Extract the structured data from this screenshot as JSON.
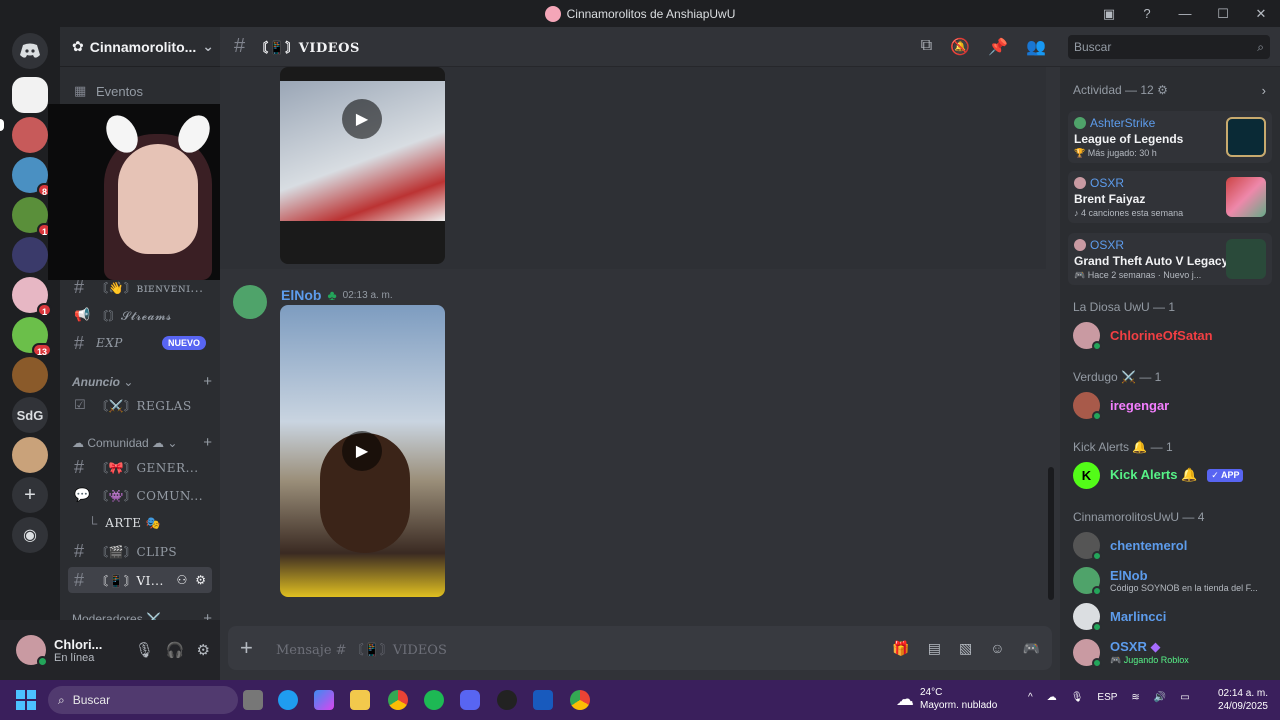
{
  "window": {
    "title": "Cinnamorolitos de AnshiapUwU"
  },
  "guild": {
    "name": "Cinnamorolito...",
    "events": "Eventos"
  },
  "rail": {
    "dm": "Discord",
    "sdg": "SdG",
    "badges": [
      "8",
      "1",
      "1",
      "13"
    ]
  },
  "channels": {
    "bienvenida": "〘👋〙ʙɪᴇɴᴠᴇɴɪ...",
    "streams": "〘〙𝓢𝓽𝓻𝓮𝓪𝓶𝓼",
    "exp": "EXP",
    "nuevo": "NUEVO",
    "cat_anuncio": "Anuncio",
    "reglas": "〘⚔️〙REGLAS",
    "cat_comunidad": "Comunidad",
    "general": "〘🎀〙GENER...",
    "comunidad": "〘👾〙COMUN...",
    "arte": "ARTE 🎭",
    "clips": "〘🎬〙CLIPS",
    "videos": "〘📱〙VI...",
    "cat_moderadores": "Moderadores ⚔️"
  },
  "user": {
    "name": "Chlori...",
    "status": "En línea"
  },
  "chat": {
    "channel_name": "〘📱〙VIDEOS",
    "author": "ElNob",
    "time": "02:13 a. m.",
    "composer_placeholder": "Mensaje # 〘📱〙VIDEOS"
  },
  "search": {
    "placeholder": "Buscar"
  },
  "activity": {
    "title": "Actividad — 12",
    "cards": [
      {
        "user": "AshterStrike",
        "game": "League of Legends",
        "detail": "Más jugado: 30 h"
      },
      {
        "user": "OSXR",
        "game": "Brent Faiyaz",
        "detail": "4 canciones esta semana"
      },
      {
        "user": "OSXR",
        "game": "Grand Theft Auto V Legacy",
        "detail": "Hace 2 semanas · Nuevo j..."
      }
    ]
  },
  "groups": {
    "diosa": "La Diosa UwU — 1",
    "verdugo": "Verdugo ⚔️ — 1",
    "kick": "Kick Alerts 🔔 — 1",
    "cinna": "CinnamorolitosUwU — 4"
  },
  "members": {
    "chlorine": "ChlorineOfSatan",
    "iregengar": "iregengar",
    "kick": "Kick Alerts 🔔",
    "app": "✓ APP",
    "chentemerol": "chentemerol",
    "elnob": "ElNob",
    "elnob_sub": "Código SOYNOB en la tienda del F...",
    "marlincci": "Marlincci",
    "osxr": "OSXR",
    "osxr_sub": "🎮 Jugando Roblox"
  },
  "taskbar": {
    "search": "Buscar",
    "temp": "24°C",
    "weather": "Mayorm. nublado",
    "lang": "ESP",
    "time": "02:14 a. m.",
    "date": "24/09/2025"
  },
  "colors": {
    "accent": "#5865f2",
    "online": "#23a55a",
    "link": "#5d9cec",
    "red_name": "#f23f43",
    "pink_name": "#f47fff",
    "green_name": "#57f287"
  }
}
